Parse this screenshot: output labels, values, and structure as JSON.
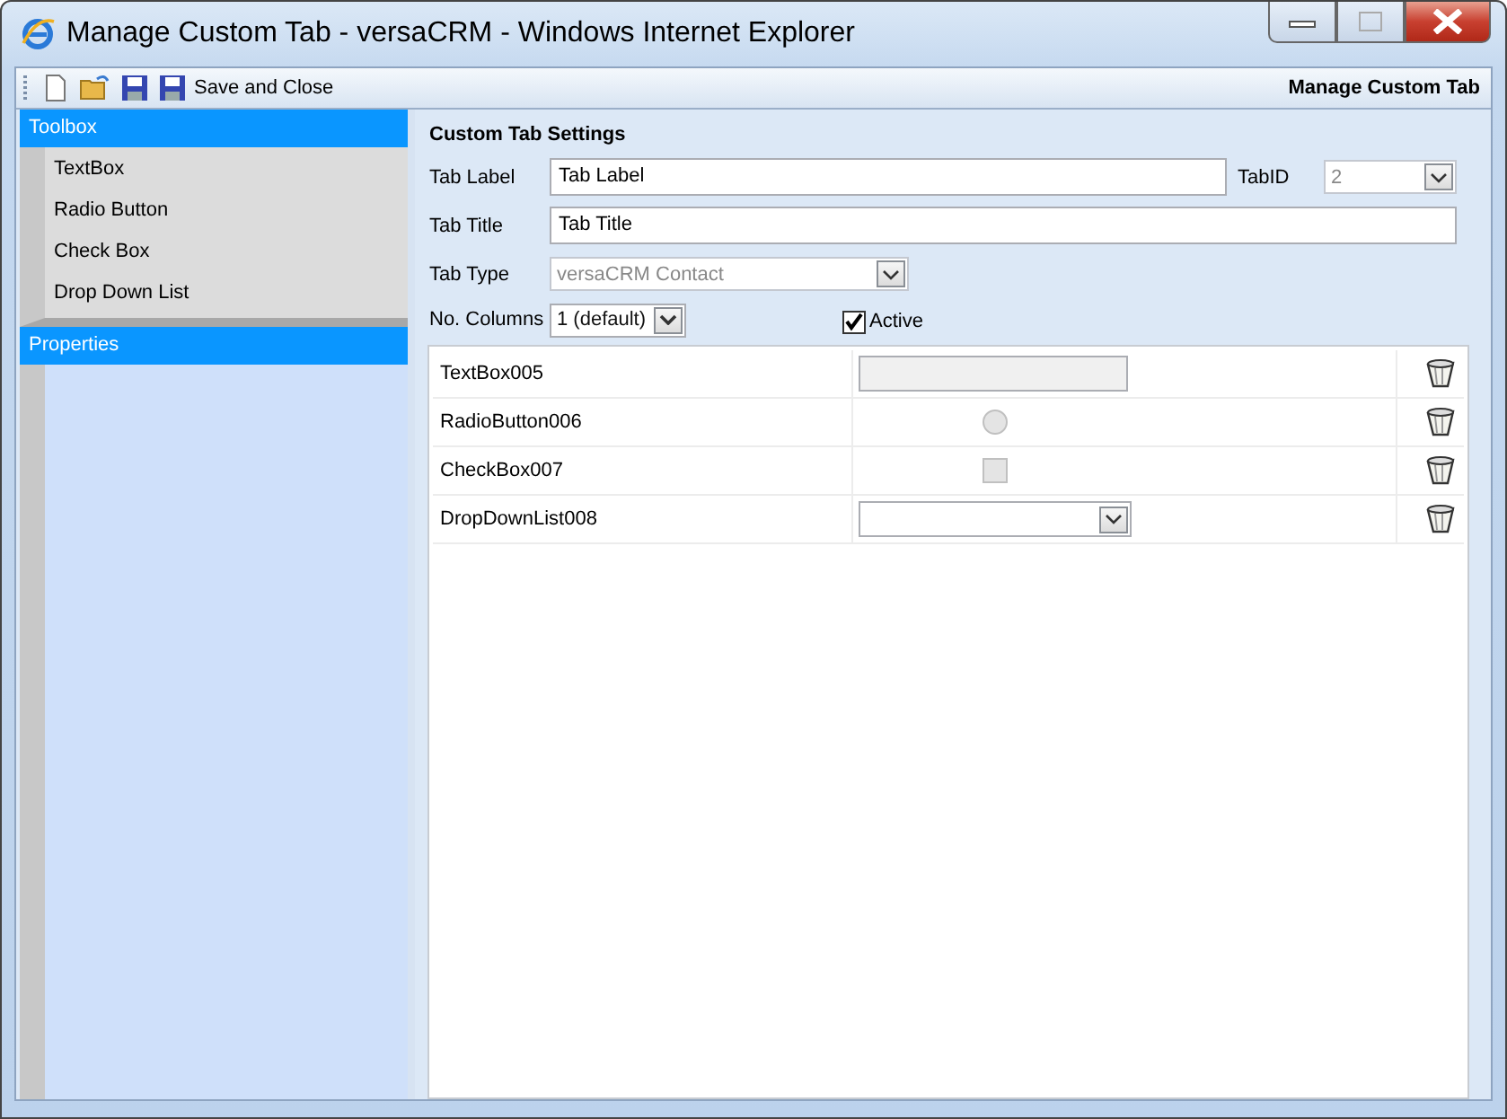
{
  "window": {
    "title": "Manage Custom Tab - versaCRM - Windows Internet Explorer"
  },
  "toolbar": {
    "buttons": [
      {
        "kind": "new"
      },
      {
        "kind": "open"
      },
      {
        "kind": "save"
      },
      {
        "kind": "save_close",
        "label": "Save and Close"
      }
    ],
    "title": "Manage Custom Tab"
  },
  "sidebar": {
    "sections": [
      {
        "title": "Toolbox",
        "items": [
          "TextBox",
          "Radio Button",
          "Check Box",
          "Drop Down List"
        ]
      },
      {
        "title": "Properties"
      }
    ]
  },
  "settings": {
    "heading": "Custom Tab Settings",
    "tab_label": {
      "label": "Tab Label",
      "value": "Tab Label"
    },
    "tab_id": {
      "label": "TabID",
      "value": "2",
      "disabled": true
    },
    "tab_title": {
      "label": "Tab Title",
      "value": "Tab Title"
    },
    "tab_type": {
      "label": "Tab Type",
      "value": "versaCRM Contact",
      "disabled": true
    },
    "columns": {
      "label": "No. Columns",
      "value": "1 (default)"
    },
    "active": {
      "label": "Active",
      "checked": true
    }
  },
  "controls": [
    {
      "name": "TextBox005",
      "kind": "textbox"
    },
    {
      "name": "RadioButton006",
      "kind": "radio"
    },
    {
      "name": "CheckBox007",
      "kind": "checkbox"
    },
    {
      "name": "DropDownList008",
      "kind": "dropdown"
    }
  ]
}
